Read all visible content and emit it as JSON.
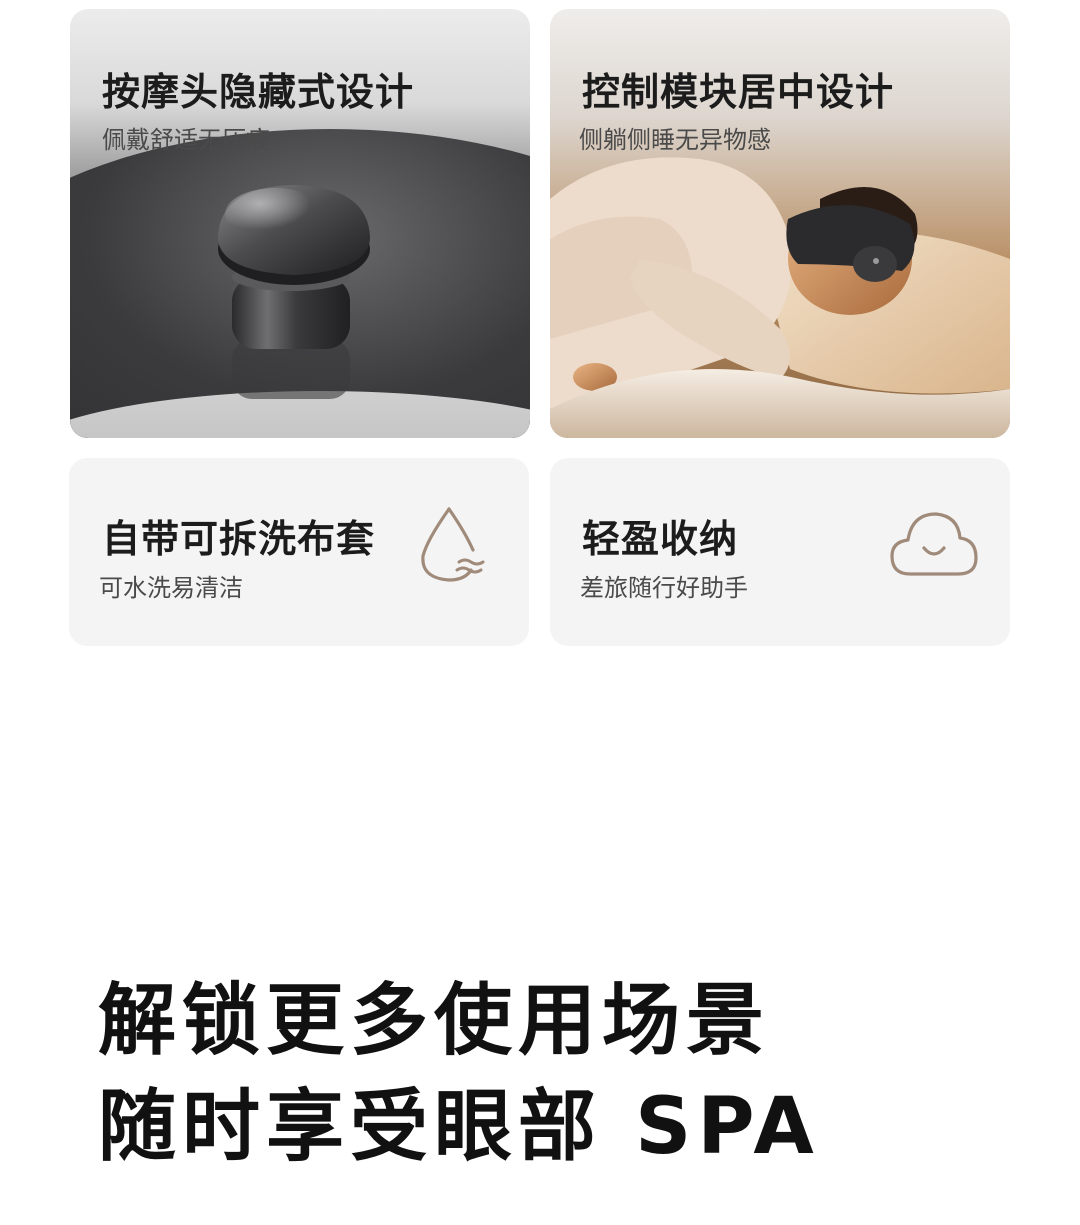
{
  "cards": {
    "massage": {
      "title": "按摩头隐藏式设计",
      "subtitle": "佩戴舒适无压痕"
    },
    "control": {
      "title": "控制模块居中设计",
      "subtitle": "侧躺侧睡无异物感"
    },
    "wash": {
      "title": "自带可拆洗布套",
      "subtitle": "可水洗易清洁",
      "icon": "water-drop-icon"
    },
    "light": {
      "title": "轻盈收纳",
      "subtitle": "差旅随行好助手",
      "icon": "smiling-cloud-icon"
    }
  },
  "slogan": {
    "line1": "解锁更多使用场景",
    "line2": "随时享受眼部 SPA"
  },
  "colors": {
    "icon_stroke": "#a08a7a",
    "card_bg": "#f4f4f4",
    "text_primary": "#1c1c1c"
  }
}
